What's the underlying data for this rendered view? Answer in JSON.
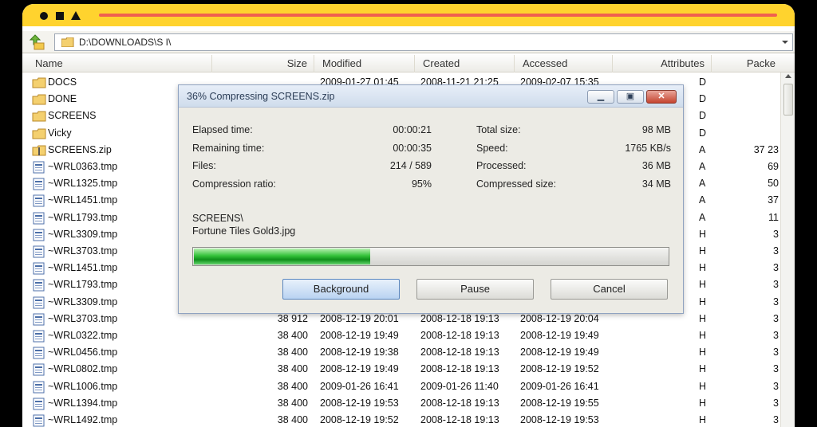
{
  "address": {
    "path": "D:\\DOWNLOADS\\S I\\"
  },
  "columns": {
    "name": "Name",
    "size": "Size",
    "modified": "Modified",
    "created": "Created",
    "accessed": "Accessed",
    "attributes": "Attributes",
    "packed": "Packe"
  },
  "files": [
    {
      "name": "DOCS",
      "icon": "folder",
      "size": "",
      "modified": "2009-01-27 01:45",
      "created": "2008-11-21 21:25",
      "accessed": "2009-02-07 15:35",
      "attr": "D",
      "packed": ""
    },
    {
      "name": "DONE",
      "icon": "folder",
      "size": "",
      "modified": "",
      "created": "",
      "accessed": "",
      "attr": "D",
      "packed": ""
    },
    {
      "name": "SCREENS",
      "icon": "folder",
      "size": "",
      "modified": "",
      "created": "",
      "accessed": "",
      "attr": "D",
      "packed": ""
    },
    {
      "name": "Vicky",
      "icon": "folder",
      "size": "",
      "modified": "",
      "created": "",
      "accessed": "",
      "attr": "D",
      "packed": ""
    },
    {
      "name": "SCREENS.zip",
      "icon": "zip",
      "size": "",
      "modified": "",
      "created": "",
      "accessed": "",
      "attr": "A",
      "packed": "37 23"
    },
    {
      "name": "~WRL0363.tmp",
      "icon": "tmp",
      "size": "",
      "modified": "",
      "created": "",
      "accessed": "",
      "attr": "A",
      "packed": "69"
    },
    {
      "name": "~WRL1325.tmp",
      "icon": "tmp",
      "size": "",
      "modified": "",
      "created": "",
      "accessed": "",
      "attr": "A",
      "packed": "50"
    },
    {
      "name": "~WRL1451.tmp",
      "icon": "tmp",
      "size": "",
      "modified": "",
      "created": "",
      "accessed": "",
      "attr": "A",
      "packed": "37"
    },
    {
      "name": "~WRL1793.tmp",
      "icon": "tmp",
      "size": "",
      "modified": "",
      "created": "",
      "accessed": "",
      "attr": "A",
      "packed": "11"
    },
    {
      "name": "~WRL3309.tmp",
      "icon": "tmp",
      "size": "",
      "modified": "",
      "created": "",
      "accessed": "",
      "attr": "H",
      "packed": "3"
    },
    {
      "name": "~WRL3703.tmp",
      "icon": "tmp",
      "size": "",
      "modified": "",
      "created": "",
      "accessed": "",
      "attr": "H",
      "packed": "3"
    },
    {
      "name": "~WRL1451.tmp",
      "icon": "tmp",
      "size": "",
      "modified": "",
      "created": "",
      "accessed": "",
      "attr": "H",
      "packed": "3"
    },
    {
      "name": "~WRL1793.tmp",
      "icon": "tmp",
      "size": "",
      "modified": "",
      "created": "",
      "accessed": "",
      "attr": "H",
      "packed": "3"
    },
    {
      "name": "~WRL3309.tmp",
      "icon": "tmp",
      "size": "",
      "modified": "",
      "created": "",
      "accessed": "",
      "attr": "H",
      "packed": "3"
    },
    {
      "name": "~WRL3703.tmp",
      "icon": "tmp",
      "size": "38 912",
      "modified": "2008-12-19 20:01",
      "created": "2008-12-18 19:13",
      "accessed": "2008-12-19 20:04",
      "attr": "H",
      "packed": "3"
    },
    {
      "name": "~WRL0322.tmp",
      "icon": "tmp",
      "size": "38 400",
      "modified": "2008-12-19 19:49",
      "created": "2008-12-18 19:13",
      "accessed": "2008-12-19 19:49",
      "attr": "H",
      "packed": "3"
    },
    {
      "name": "~WRL0456.tmp",
      "icon": "tmp",
      "size": "38 400",
      "modified": "2008-12-19 19:38",
      "created": "2008-12-18 19:13",
      "accessed": "2008-12-19 19:49",
      "attr": "H",
      "packed": "3"
    },
    {
      "name": "~WRL0802.tmp",
      "icon": "tmp",
      "size": "38 400",
      "modified": "2008-12-19 19:49",
      "created": "2008-12-18 19:13",
      "accessed": "2008-12-19 19:52",
      "attr": "H",
      "packed": "3"
    },
    {
      "name": "~WRL1006.tmp",
      "icon": "tmp",
      "size": "38 400",
      "modified": "2009-01-26 16:41",
      "created": "2009-01-26 11:40",
      "accessed": "2009-01-26 16:41",
      "attr": "H",
      "packed": "3"
    },
    {
      "name": "~WRL1394.tmp",
      "icon": "tmp",
      "size": "38 400",
      "modified": "2008-12-19 19:53",
      "created": "2008-12-18 19:13",
      "accessed": "2008-12-19 19:55",
      "attr": "H",
      "packed": "3"
    },
    {
      "name": "~WRL1492.tmp",
      "icon": "tmp",
      "size": "38 400",
      "modified": "2008-12-19 19:52",
      "created": "2008-12-18 19:13",
      "accessed": "2008-12-19 19:53",
      "attr": "H",
      "packed": "3"
    }
  ],
  "dialog": {
    "title": "36% Compressing SCREENS.zip",
    "elapsed_label": "Elapsed time:",
    "elapsed": "00:00:21",
    "remaining_label": "Remaining time:",
    "remaining": "00:00:35",
    "files_label": "Files:",
    "files": "214 / 589",
    "ratio_label": "Compression ratio:",
    "ratio": "95%",
    "total_label": "Total size:",
    "total": "98 MB",
    "speed_label": "Speed:",
    "speed": "1765 KB/s",
    "processed_label": "Processed:",
    "processed": "36 MB",
    "compressed_label": "Compressed size:",
    "compressed": "34 MB",
    "current_dir": "SCREENS\\",
    "current_file": "Fortune Tiles Gold3.jpg",
    "progress": 0.37,
    "background_btn": "Background",
    "pause_btn": "Pause",
    "cancel_btn": "Cancel"
  },
  "colors": {
    "topbar": "#ffd32e",
    "topbar_line": "#f0614f",
    "progress": "#35c23a"
  }
}
